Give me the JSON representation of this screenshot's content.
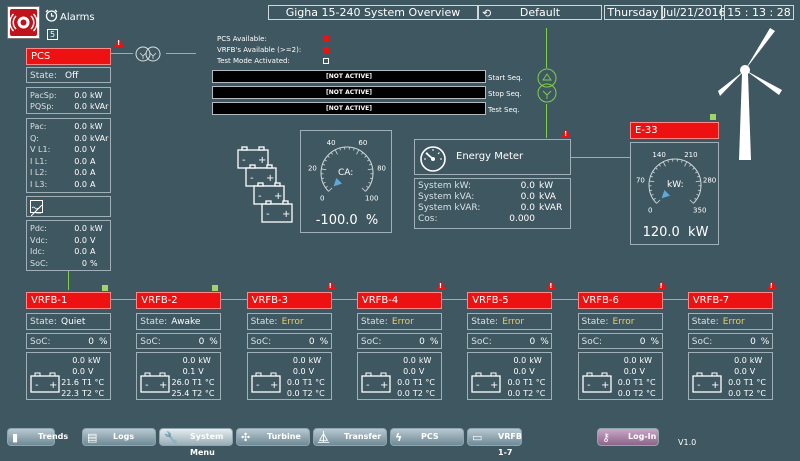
{
  "header": {
    "alarms_label": "Alarms",
    "alarm_count": "5",
    "title": "Gigha 15-240 System Overview",
    "profile": "Default",
    "day": "Thursday",
    "date": "Jul/21/2016",
    "time": "15 : 13 : 28"
  },
  "pcs": {
    "title": "PCS",
    "state_label": "State:",
    "state": "Off",
    "pacsp_label": "PacSp:",
    "pacsp": "0.0",
    "pacsp_unit": "kW",
    "pqsp_label": "PQSp:",
    "pqsp": "0.0",
    "pqsp_unit": "kVAr",
    "ac_rows": [
      {
        "label": "Pac:",
        "value": "0.0",
        "unit": "kW"
      },
      {
        "label": "Q:",
        "value": "0.0",
        "unit": "kVAr"
      },
      {
        "label": "V L1:",
        "value": "0.0",
        "unit": "V"
      },
      {
        "label": "I L1:",
        "value": "0.0",
        "unit": "A"
      },
      {
        "label": "I L2:",
        "value": "0.0",
        "unit": "A"
      },
      {
        "label": "I L3:",
        "value": "0.0",
        "unit": "A"
      }
    ],
    "dc_rows": [
      {
        "label": "Pdc:",
        "value": "0.0",
        "unit": "kW"
      },
      {
        "label": "Vdc:",
        "value": "0.0",
        "unit": "V"
      },
      {
        "label": "Idc:",
        "value": "0.0",
        "unit": "A"
      },
      {
        "label": "SoC:",
        "value": "0",
        "unit": "%"
      }
    ]
  },
  "availability": {
    "pcs_available": "PCS Available:",
    "vrfb_available": "VRFB's Available (>=2):",
    "test_mode": "Test Mode Activated:"
  },
  "sequences": [
    {
      "status": "[NOT ACTIVE]",
      "label": "Start Seq."
    },
    {
      "status": "[NOT ACTIVE]",
      "label": "Stop Seq."
    },
    {
      "status": "[NOT ACTIVE]",
      "label": "Test Seq."
    }
  ],
  "ca_gauge": {
    "label": "CA:",
    "ticks": [
      "0",
      "20",
      "40",
      "60",
      "80",
      "100"
    ],
    "value": 0,
    "readout": "-100.0  %"
  },
  "energy_meter": {
    "title": "Energy Meter",
    "rows": [
      {
        "label": "System kW:",
        "value": "0.0",
        "unit": "kW"
      },
      {
        "label": "System kVA:",
        "value": "0.0",
        "unit": "kVA"
      },
      {
        "label": "System kVAR:",
        "value": "0.0",
        "unit": "kVAR"
      },
      {
        "label": "Cos:",
        "value": "0.000",
        "unit": ""
      }
    ]
  },
  "e33": {
    "title": "E-33",
    "label": "kW:",
    "ticks": [
      "0",
      "70",
      "140",
      "210",
      "280",
      "350"
    ],
    "value": 0,
    "readout": "120.0  kW"
  },
  "vrfbs": [
    {
      "title": "VRFB-1",
      "state": "Quiet",
      "state_color": "#ffffff",
      "soc": "0",
      "power": "0.0",
      "voltage": "0.0",
      "t1": "21.6",
      "t2": "22.3",
      "flag": "ok"
    },
    {
      "title": "VRFB-2",
      "state": "Awake",
      "state_color": "#ffffff",
      "soc": "0",
      "power": "0.0",
      "voltage": "0.1",
      "t1": "26.0",
      "t2": "25.4",
      "flag": "ok"
    },
    {
      "title": "VRFB-3",
      "state": "Error",
      "state_color": "#e6cf6a",
      "soc": "0",
      "power": "0.0",
      "voltage": "0.0",
      "t1": "0.0",
      "t2": "0.0",
      "flag": "alarm"
    },
    {
      "title": "VRFB-4",
      "state": "Error",
      "state_color": "#e6cf6a",
      "soc": "0",
      "power": "0.0",
      "voltage": "0.0",
      "t1": "0.0",
      "t2": "0.0",
      "flag": "alarm"
    },
    {
      "title": "VRFB-5",
      "state": "Error",
      "state_color": "#e6cf6a",
      "soc": "0",
      "power": "0.0",
      "voltage": "0.0",
      "t1": "0.0",
      "t2": "0.0",
      "flag": "alarm"
    },
    {
      "title": "VRFB-6",
      "state": "Error",
      "state_color": "#e6cf6a",
      "soc": "0",
      "power": "0.0",
      "voltage": "0.0",
      "t1": "0.0",
      "t2": "0.0",
      "flag": "alarm"
    },
    {
      "title": "VRFB-7",
      "state": "Error",
      "state_color": "#e6cf6a",
      "soc": "0",
      "power": "0.0",
      "voltage": "0.0",
      "t1": "0.0",
      "t2": "0.0",
      "flag": "alarm"
    }
  ],
  "vrfb_labels": {
    "state": "State:",
    "soc": "SoC:",
    "percent": "%",
    "kw": "kW",
    "v": "V",
    "t1": "T1 °C",
    "t2": "T2 °C"
  },
  "nav": [
    {
      "name": "trends",
      "label": "Trends",
      "icon": "chart-icon"
    },
    {
      "name": "logs",
      "label": "Logs",
      "icon": "log-icon"
    },
    {
      "name": "system-menu",
      "label": "System Menu",
      "icon": "wrench-icon"
    },
    {
      "name": "turbine",
      "label": "Turbine",
      "icon": "turbine-icon"
    },
    {
      "name": "transfer",
      "label": "Transfer",
      "icon": "pylon-icon"
    },
    {
      "name": "pcs",
      "label": "PCS",
      "icon": "bolt-icon"
    },
    {
      "name": "vrfb",
      "label": "VRFB 1-7",
      "icon": "battery-icon"
    },
    {
      "name": "login",
      "label": "Log-In",
      "icon": "key-icon"
    }
  ],
  "version": "V1.0",
  "colors": {
    "background": "#3f5761",
    "alarm_red": "#ee1111",
    "connector_green": "#7fd04a",
    "error_yellow": "#e6cf6a"
  }
}
